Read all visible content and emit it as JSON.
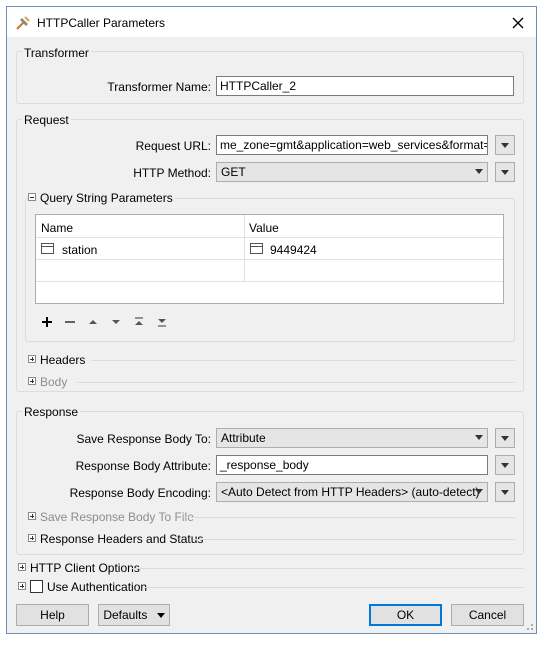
{
  "window": {
    "title": "HTTPCaller Parameters"
  },
  "transformer": {
    "group_title": "Transformer",
    "name_label": "Transformer Name:",
    "name_value": "HTTPCaller_2"
  },
  "request": {
    "group_title": "Request",
    "url_label": "Request URL:",
    "url_value": "me_zone=gmt&application=web_services&format=json",
    "method_label": "HTTP Method:",
    "method_value": "GET",
    "query": {
      "title": "Query String Parameters",
      "columns": [
        "Name",
        "Value"
      ],
      "rows": [
        {
          "name": "station",
          "value": "9449424"
        }
      ]
    },
    "headers_label": "Headers",
    "body_label": "Body"
  },
  "response": {
    "group_title": "Response",
    "save_to_label": "Save Response Body To:",
    "save_to_value": "Attribute",
    "attr_label": "Response Body Attribute:",
    "attr_value": "_response_body",
    "encoding_label": "Response Body Encoding:",
    "encoding_value": "<Auto Detect from HTTP Headers> (auto-detect)",
    "save_file_label": "Save Response Body To File",
    "headers_status_label": "Response Headers and Status"
  },
  "http_client_options_label": "HTTP Client Options",
  "use_auth_label": "Use Authentication",
  "buttons": {
    "help": "Help",
    "defaults": "Defaults",
    "ok": "OK",
    "cancel": "Cancel"
  },
  "icons": [
    "app-transformer-icon",
    "close-icon",
    "plus-icon",
    "minus-icon",
    "move-up-icon",
    "move-down-icon",
    "move-top-icon",
    "move-bottom-icon",
    "chevron-down-icon"
  ]
}
